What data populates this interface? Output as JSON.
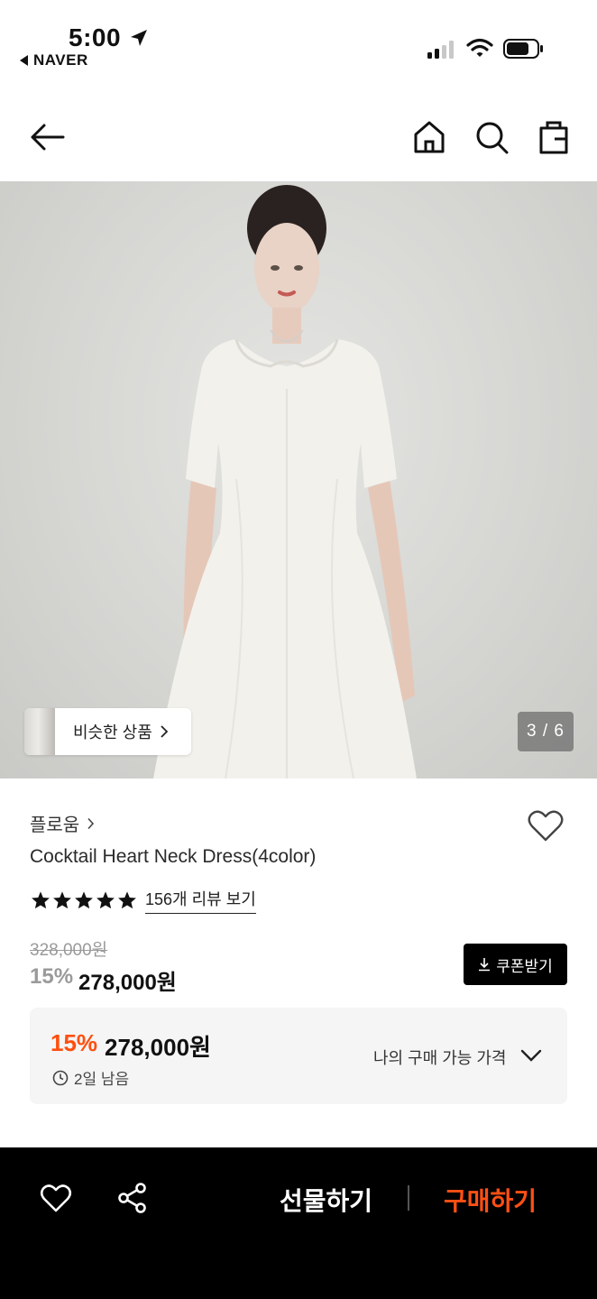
{
  "status_bar": {
    "time": "5:00",
    "back_app": "NAVER"
  },
  "nav": {
    "icons": [
      "back-arrow-icon",
      "home-icon",
      "search-icon",
      "shopping-bag-icon"
    ]
  },
  "hero": {
    "similar_label": "비슷한 상품",
    "counter": "3 / 6"
  },
  "product": {
    "brand": "플로움",
    "title": "Cocktail Heart Neck Dress(4color)",
    "rating_stars": 5,
    "review_link": "156개 리뷰 보기",
    "original_price": "328,000원",
    "discount_pct": "15%",
    "sale_price": "278,000원",
    "coupon_label": "쿠폰받기"
  },
  "benefit": {
    "discount_pct": "15%",
    "price": "278,000원",
    "remaining": "2일 남음",
    "available_label": "나의 구매 가능 가격"
  },
  "bottom_bar": {
    "gift_label": "선물하기",
    "buy_label": "구매하기"
  },
  "colors": {
    "accent": "#ff5014",
    "benefit_pct": "#ff4f0f",
    "bottom_bg": "#000000"
  }
}
